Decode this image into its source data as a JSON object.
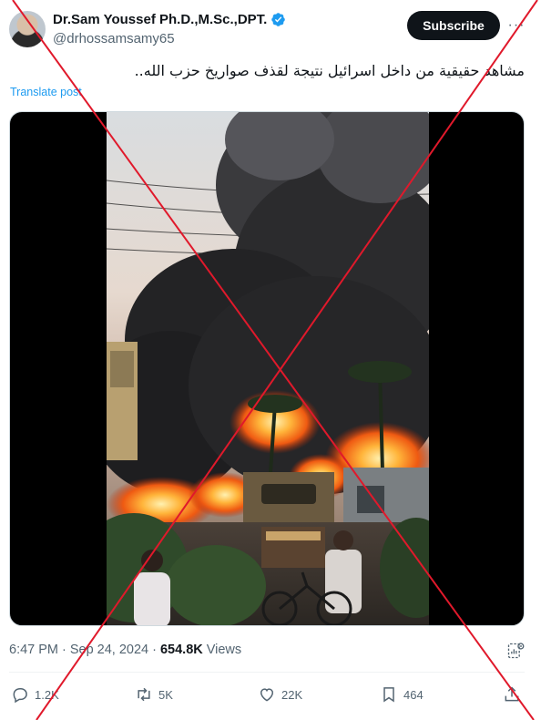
{
  "author": {
    "display_name": "Dr.Sam Youssef Ph.D.,M.Sc.,DPT.",
    "handle": "@drhossamsamy65",
    "verified": true,
    "verified_color": "#1d9bf0"
  },
  "subscribe_label": "Subscribe",
  "more_label": "···",
  "post": {
    "text": "مشاهد حقيقية من داخل اسرائيل نتيجة لقذف صواريخ حزب الله..",
    "translate_label": "Translate post"
  },
  "meta": {
    "time": "6:47 PM",
    "separator": "·",
    "date": "Sep 24, 2024",
    "separator2": "·",
    "views_count": "654.8K",
    "views_label": "Views"
  },
  "actions": {
    "replies": "1.2K",
    "reposts": "5K",
    "likes": "22K",
    "bookmarks": "464"
  },
  "overlay": {
    "type": "red-x",
    "color": "#e0192b"
  },
  "colors": {
    "text_primary": "#0f1419",
    "text_secondary": "#536471",
    "link": "#1d9bf0"
  },
  "icons": [
    "verified-badge-icon",
    "more-icon",
    "analytics-icon",
    "reply-icon",
    "repost-icon",
    "like-icon",
    "bookmark-icon",
    "share-icon"
  ]
}
